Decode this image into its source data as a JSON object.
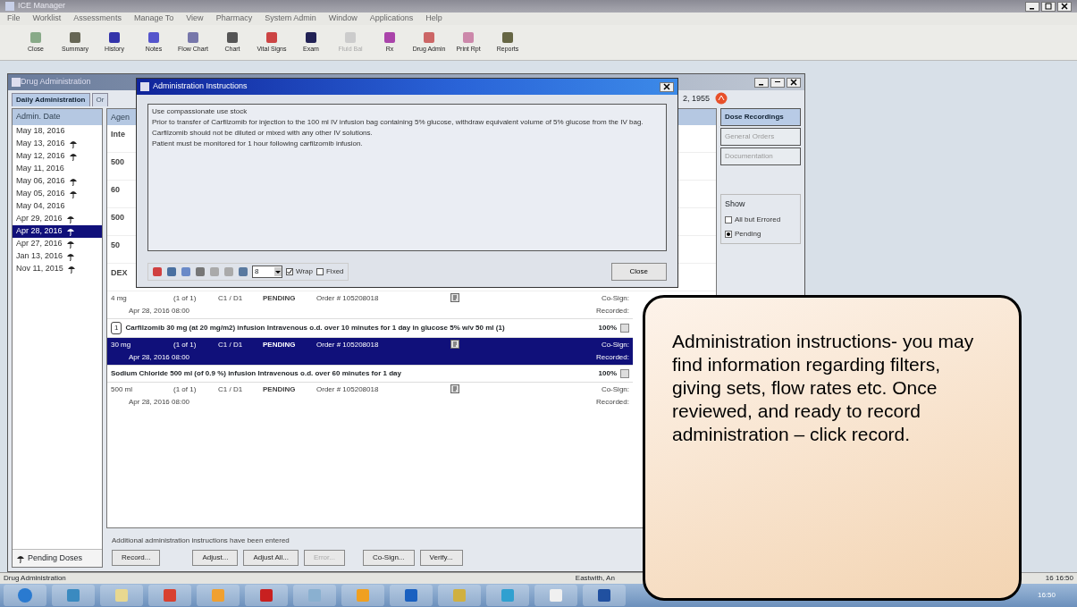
{
  "app": {
    "title": "ICE Manager",
    "menu": [
      "File",
      "Worklist",
      "Assessments",
      "Manage To",
      "View",
      "Pharmacy",
      "System Admin",
      "Window",
      "Applications",
      "Help"
    ]
  },
  "toolbar": [
    {
      "label": "Close",
      "disabled": false
    },
    {
      "label": "Summary",
      "disabled": false
    },
    {
      "label": "History",
      "disabled": false
    },
    {
      "label": "Notes",
      "disabled": false
    },
    {
      "label": "Flow Chart",
      "disabled": false
    },
    {
      "label": "Chart",
      "disabled": false
    },
    {
      "label": "Vital Signs",
      "disabled": false
    },
    {
      "label": "Exam",
      "disabled": false
    },
    {
      "label": "Fluid Bal",
      "disabled": true
    },
    {
      "label": "Rx",
      "disabled": false
    },
    {
      "label": "Drug Admin",
      "disabled": false
    },
    {
      "label": "Print Rpt",
      "disabled": false
    },
    {
      "label": "Reports",
      "disabled": false
    }
  ],
  "drug_window": {
    "title": "Drug Administration",
    "tabs": [
      {
        "label": "Daily Administration",
        "selected": true
      },
      {
        "label": "Or",
        "selected": false
      }
    ],
    "patient_dob": "2, 1955",
    "dates": {
      "header": "Admin. Date",
      "items": [
        {
          "label": "May 18, 2016",
          "flagged": false,
          "selected": false
        },
        {
          "label": "May 13, 2016",
          "flagged": true,
          "selected": false
        },
        {
          "label": "May 12, 2016",
          "flagged": true,
          "selected": false
        },
        {
          "label": "May 11, 2016",
          "flagged": false,
          "selected": false
        },
        {
          "label": "May 06, 2016",
          "flagged": true,
          "selected": false
        },
        {
          "label": "May 05, 2016",
          "flagged": true,
          "selected": false
        },
        {
          "label": "May 04, 2016",
          "flagged": false,
          "selected": false
        },
        {
          "label": "Apr 29, 2016",
          "flagged": true,
          "selected": false
        },
        {
          "label": "Apr 28, 2016",
          "flagged": true,
          "selected": true
        },
        {
          "label": "Apr 27, 2016",
          "flagged": true,
          "selected": false
        },
        {
          "label": "Jan 13, 2016",
          "flagged": true,
          "selected": false
        },
        {
          "label": "Nov 11, 2015",
          "flagged": true,
          "selected": false
        }
      ]
    },
    "pending_doses": "Pending Doses",
    "list_header": "Agen",
    "list_fragments": [
      "Inte",
      "500",
      "60",
      "500",
      "50",
      "DEX"
    ],
    "rows": [
      {
        "kind": "dose",
        "dose": "4 mg",
        "count": "(1 of 1)",
        "cycle": "C1 / D1",
        "status": "PENDING",
        "order": "Order # 105208018",
        "cosign": "Co-Sign:",
        "time": "Apr 28, 2016 08:00",
        "recorded": "Recorded:",
        "selected": false
      },
      {
        "kind": "order",
        "number": "1",
        "text": "Carfilzomib 30 mg (at 20 mg/m2) infusion Intravenous o.d. over 10 minutes for 1 day in glucose 5% w/v 50 ml (1)",
        "rate": "100%",
        "selected": false
      },
      {
        "kind": "dose",
        "dose": "30 mg",
        "count": "(1 of 1)",
        "cycle": "C1 / D1",
        "status": "PENDING",
        "order": "Order # 105208018",
        "cosign": "Co-Sign:",
        "time": "Apr 28, 2016 08:00",
        "recorded": "Recorded:",
        "selected": true
      },
      {
        "kind": "order",
        "text": "Sodium Chloride 500 ml (of 0.9 %) infusion Intravenous o.d. over 60 minutes for 1 day",
        "rate": "100%",
        "selected": false
      },
      {
        "kind": "dose",
        "dose": "500 ml",
        "count": "(1 of 1)",
        "cycle": "C1 / D1",
        "status": "PENDING",
        "order": "Order # 105208018",
        "cosign": "Co-Sign:",
        "time": "Apr 28, 2016 08:00",
        "recorded": "Recorded:",
        "selected": false
      }
    ],
    "note": "Additional administration instructions have been entered",
    "buttons": [
      {
        "label": "Record...",
        "disabled": false
      },
      {
        "label": "Adjust...",
        "disabled": false
      },
      {
        "label": "Adjust All...",
        "disabled": false
      },
      {
        "label": "Error...",
        "disabled": true
      },
      {
        "label": "Co-Sign...",
        "disabled": false
      },
      {
        "label": "Verify...",
        "disabled": false
      }
    ],
    "side_tabs": [
      {
        "label": "Dose Recordings",
        "selected": true
      },
      {
        "label": "General Orders",
        "selected": false
      },
      {
        "label": "Documentation",
        "selected": false
      }
    ],
    "show": {
      "label": "Show",
      "options": [
        {
          "label": "All but Errored",
          "selected": false
        },
        {
          "label": "Pending",
          "selected": true
        }
      ]
    }
  },
  "dialog": {
    "title": "Administration Instructions",
    "lines": [
      "Use compassionate use stock",
      "Prior to transfer of Carfilzomib for injection to the 100 ml IV infusion bag containing 5% glucose, withdraw equivalent volume of 5% glucose from the IV bag. Carfilzomib should not be diluted or mixed with any other IV solutions.",
      "Patient must be monitored for 1 hour following carfilzomib infusion."
    ],
    "font_size": "8",
    "wrap": {
      "label": "Wrap",
      "checked": true
    },
    "fixed": {
      "label": "Fixed",
      "checked": false
    },
    "close": "Close"
  },
  "status_bar": [
    "Drug Administration",
    "Eastwith, An",
    "16 16:50"
  ],
  "taskbar_clock": "16:50",
  "callout": "Administration instructions- you may find information regarding filters, giving sets, flow rates etc. Once reviewed, and ready to record administration – click record."
}
